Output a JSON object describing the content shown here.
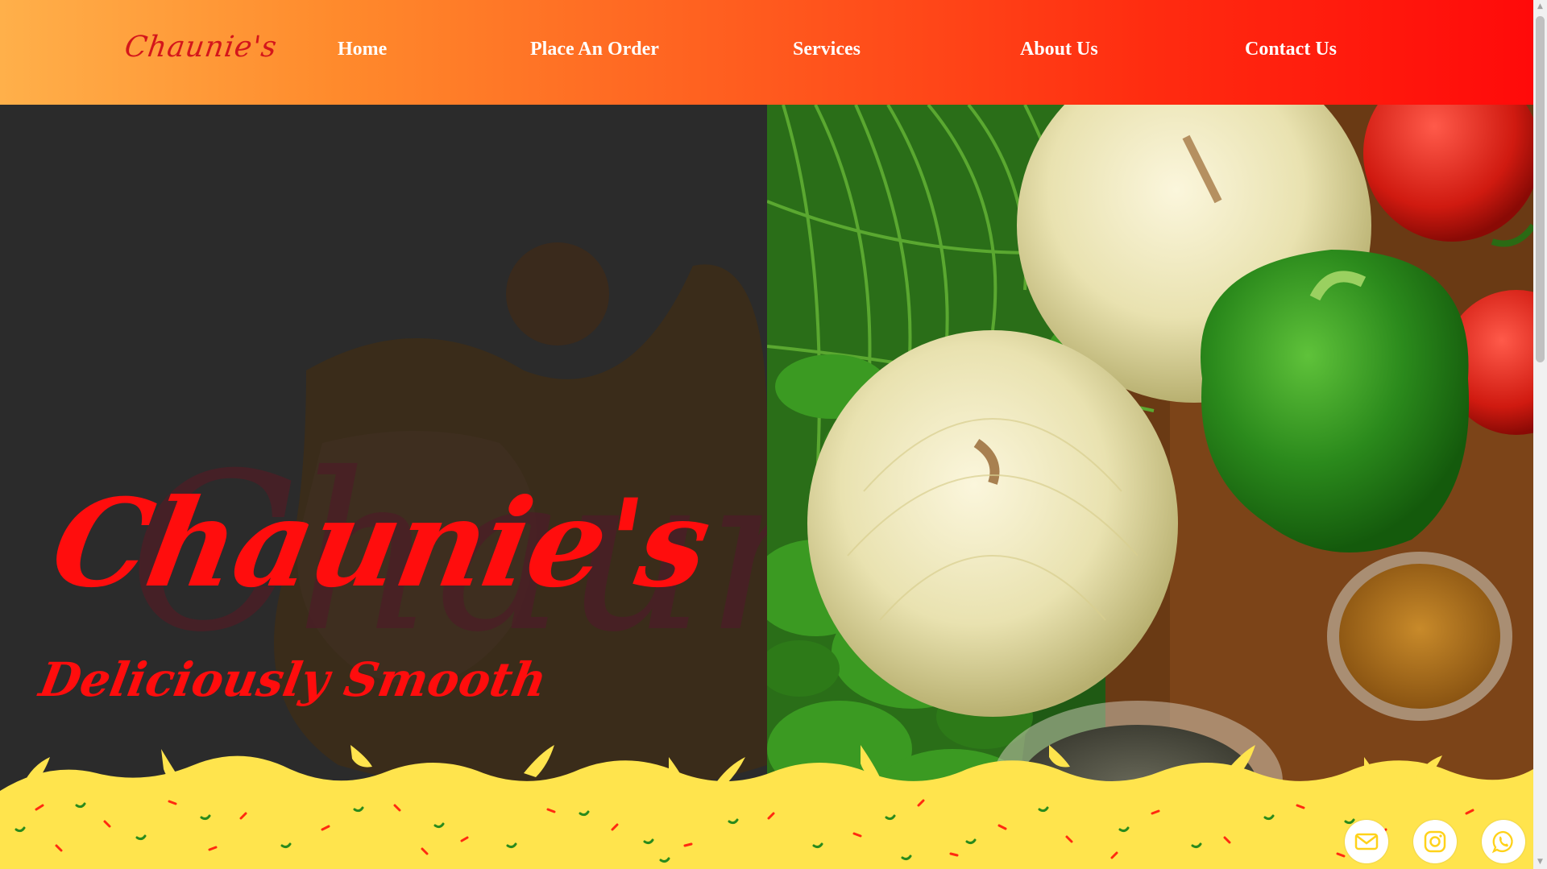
{
  "header": {
    "logo": "Chaunie's",
    "nav": {
      "home": "Home",
      "order": "Place An Order",
      "services": "Services",
      "about": "About Us",
      "contact": "Contact Us"
    }
  },
  "hero": {
    "title": "Chaunie's",
    "tagline": "Deliciously Smooth",
    "background_logo": "Chaunie's"
  },
  "social": {
    "mail": "mail-icon",
    "instagram": "instagram-icon",
    "whatsapp": "whatsapp-icon"
  },
  "colors": {
    "header_start": "#ffb04a",
    "header_end": "#ff0a0a",
    "brand_red": "#ff0d0d",
    "wave_yellow": "#ffe44d",
    "panel_dark": "#2b2b2b"
  }
}
